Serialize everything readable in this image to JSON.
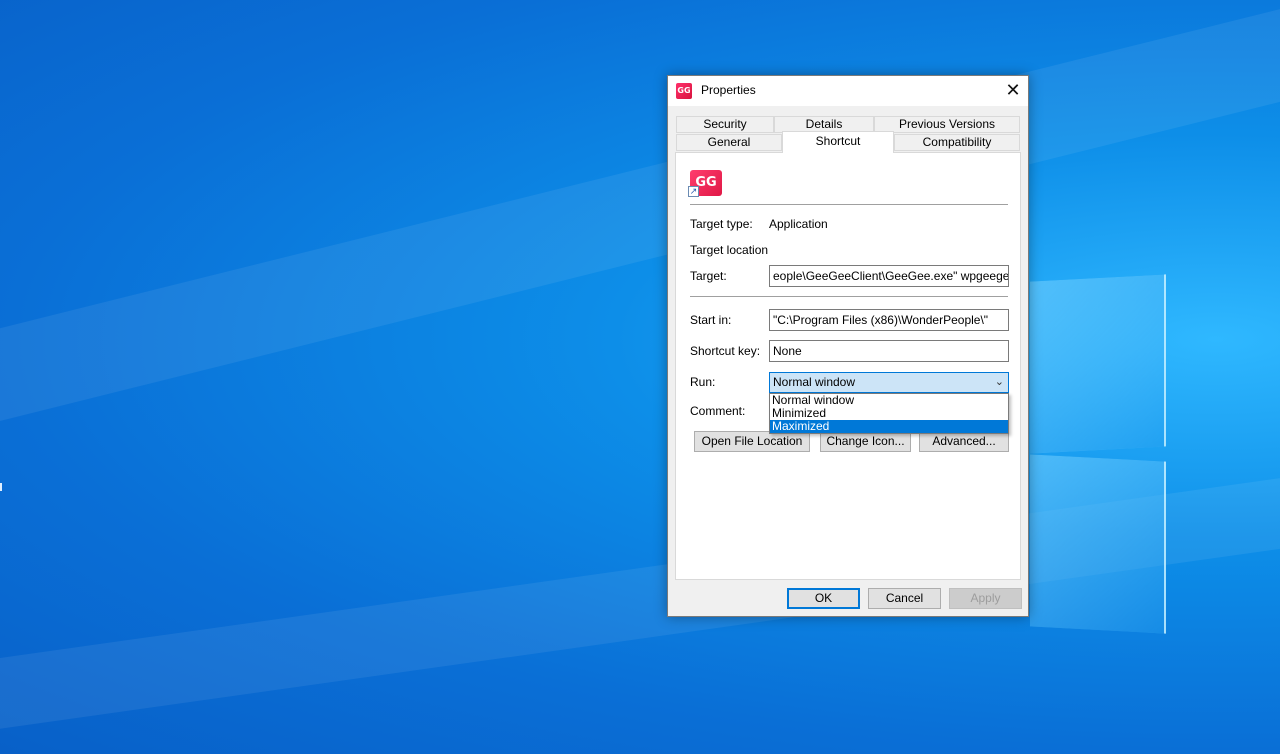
{
  "dialog": {
    "title": "Properties",
    "close_glyph": "✕",
    "app_icon_text": "GG",
    "icon_shortcut_glyph": "↗"
  },
  "tabs": {
    "row1": [
      "Security",
      "Details",
      "Previous Versions"
    ],
    "row2": [
      "General",
      "Shortcut",
      "Compatibility"
    ],
    "active": "Shortcut"
  },
  "shortcut": {
    "target_type_label": "Target type:",
    "target_type_value": "Application",
    "target_location_label": "Target location",
    "target_label": "Target:",
    "target_value": "eople\\GeeGeeClient\\GeeGee.exe\" wpgeegee://",
    "start_in_label": "Start in:",
    "start_in_value": "\"C:\\Program Files (x86)\\WonderPeople\\\"",
    "shortcut_key_label": "Shortcut key:",
    "shortcut_key_value": "None",
    "run_label": "Run:",
    "run_value": "Normal window",
    "run_options": [
      "Normal window",
      "Minimized",
      "Maximized"
    ],
    "run_highlighted": "Maximized",
    "comment_label": "Comment:",
    "open_file_location": "Open File Location",
    "change_icon": "Change Icon...",
    "advanced": "Advanced..."
  },
  "footer": {
    "ok": "OK",
    "cancel": "Cancel",
    "apply": "Apply"
  },
  "colors": {
    "accent": "#0078d7",
    "desktop": "#0a7fe0",
    "app_brand": "#e8194a"
  }
}
